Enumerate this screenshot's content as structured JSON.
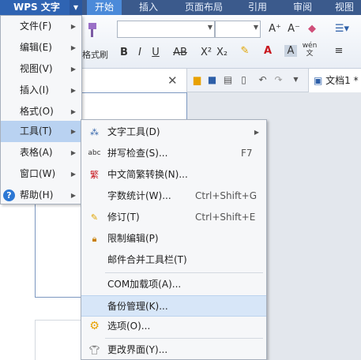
{
  "app": {
    "title": "WPS 文字"
  },
  "ribbon_tabs": [
    {
      "label": "开始",
      "active": true
    },
    {
      "label": "插入"
    },
    {
      "label": "页面布局"
    },
    {
      "label": "引用"
    },
    {
      "label": "审阅"
    },
    {
      "label": "视图"
    }
  ],
  "ribbon": {
    "format_painter_label": "格式刷",
    "bold": "B",
    "italic": "I",
    "underline": "U",
    "strike": "AB",
    "superscript": "X²",
    "subscript": "X₂",
    "grow_font": "A⁺",
    "shrink_font": "A⁻",
    "pinyin": "wén 文"
  },
  "doc_tab": {
    "label": "文档1 *"
  },
  "main_menu": [
    {
      "label": "文件(F)",
      "has_submenu": true
    },
    {
      "label": "编辑(E)",
      "has_submenu": true
    },
    {
      "label": "视图(V)",
      "has_submenu": true
    },
    {
      "label": "插入(I)",
      "has_submenu": true
    },
    {
      "label": "格式(O)",
      "has_submenu": true
    },
    {
      "label": "工具(T)",
      "has_submenu": true,
      "highlighted": true
    },
    {
      "label": "表格(A)",
      "has_submenu": true
    },
    {
      "label": "窗口(W)",
      "has_submenu": true
    },
    {
      "label": "帮助(H)",
      "has_submenu": true,
      "icon": "help-icon"
    }
  ],
  "tools_submenu": [
    {
      "label": "文字工具(D)",
      "icon": "text-tools-icon",
      "has_submenu": true
    },
    {
      "label": "拼写检查(S)...",
      "shortcut": "F7",
      "icon": "spell-check-icon"
    },
    {
      "label": "中文简繁转换(N)...",
      "icon": "chinese-convert-icon"
    },
    {
      "label": "字数统计(W)...",
      "shortcut": "Ctrl+Shift+G"
    },
    {
      "label": "修订(T)",
      "shortcut": "Ctrl+Shift+E",
      "icon": "track-changes-icon"
    },
    {
      "label": "限制编辑(P)",
      "icon": "restrict-edit-icon"
    },
    {
      "label": "邮件合并工具栏(T)"
    },
    {
      "label": "COM加载项(A)..."
    },
    {
      "label": "备份管理(K)...",
      "highlighted": true
    },
    {
      "label": "选项(O)...",
      "icon": "options-gear-icon"
    },
    {
      "label": "更改界面(Y)...",
      "icon": "change-ui-icon"
    }
  ],
  "colors": {
    "accent": "#2f64b3",
    "menu_highlight": "#b9d2f1",
    "submenu_highlight": "#d7e6f8"
  }
}
